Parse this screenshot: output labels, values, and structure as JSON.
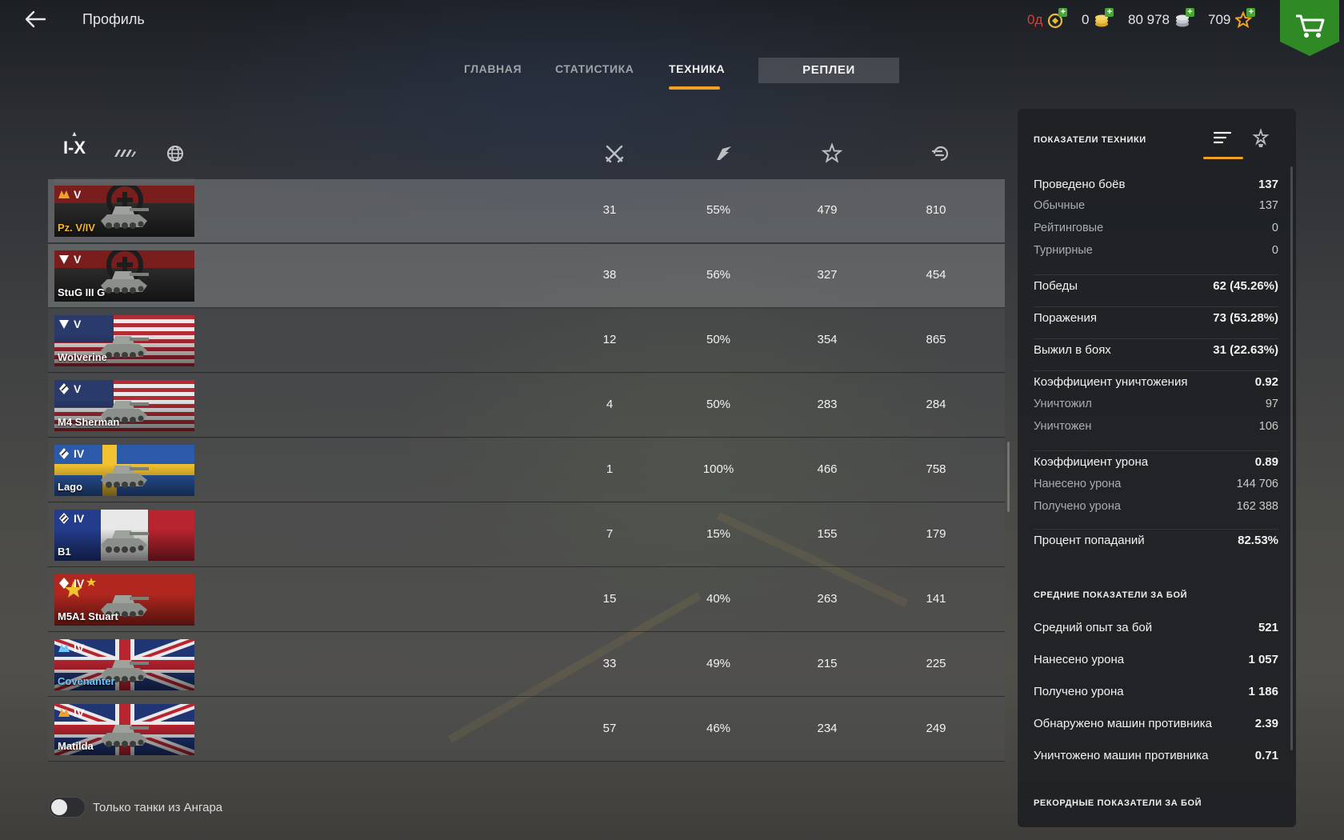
{
  "header": {
    "title": "Профиль",
    "currencies": [
      {
        "value": "0д",
        "icon": "premium-icon",
        "color": "#e83a2e"
      },
      {
        "value": "0",
        "icon": "gold-icon",
        "color": "#e4e4e4"
      },
      {
        "value": "80 978",
        "icon": "credits-icon",
        "color": "#e4e4e4"
      },
      {
        "value": "709",
        "icon": "free-xp-icon",
        "color": "#e4e4e4"
      }
    ],
    "plus": "+"
  },
  "tabs": {
    "main": "ГЛАВНАЯ",
    "stats": "СТАТИСТИКА",
    "vehicles": "ТЕХНИКА",
    "replays": "РЕПЛЕИ",
    "active": "vehicles"
  },
  "filters": {
    "tier": "I-X",
    "caret": "▲",
    "type_icon": "vehicle-type-icon",
    "nation_icon": "globe-icon"
  },
  "columns": [
    {
      "icon": "battles-icon"
    },
    {
      "icon": "winrate-icon"
    },
    {
      "icon": "avg-xp-icon"
    },
    {
      "icon": "avg-damage-icon"
    }
  ],
  "vehicles": [
    {
      "name": "Pz. V/IV",
      "tier": "V",
      "nation": "germany",
      "name_color": "#f5b82b",
      "badge": "mastery-icon",
      "battles": "31",
      "winrate": "55%",
      "xp": "479",
      "damage": "810",
      "highlighted": true
    },
    {
      "name": "StuG III G",
      "tier": "V",
      "nation": "germany",
      "name_color": "#ffffff",
      "badge": "td-icon",
      "battles": "38",
      "winrate": "56%",
      "xp": "327",
      "damage": "454",
      "highlighted": true
    },
    {
      "name": "Wolverine",
      "tier": "V",
      "nation": "usa",
      "name_color": "#ffffff",
      "badge": "td-icon",
      "battles": "12",
      "winrate": "50%",
      "xp": "354",
      "damage": "865",
      "highlighted": false
    },
    {
      "name": "M4 Sherman",
      "tier": "V",
      "nation": "usa",
      "name_color": "#ffffff",
      "badge": "medium-tank-icon",
      "battles": "4",
      "winrate": "50%",
      "xp": "283",
      "damage": "284",
      "highlighted": false
    },
    {
      "name": "Lago",
      "tier": "IV",
      "nation": "sweden",
      "name_color": "#ffffff",
      "badge": "medium-tank-icon",
      "battles": "1",
      "winrate": "100%",
      "xp": "466",
      "damage": "758",
      "highlighted": false
    },
    {
      "name": "B1",
      "tier": "IV",
      "nation": "france",
      "name_color": "#ffffff",
      "badge": "heavy-tank-icon",
      "battles": "7",
      "winrate": "15%",
      "xp": "155",
      "damage": "179",
      "highlighted": false
    },
    {
      "name": "M5A1 Stuart",
      "tier": "IV",
      "nation": "china",
      "name_color": "#ffffff",
      "badge": "light-tank-icon",
      "battles": "15",
      "winrate": "40%",
      "xp": "263",
      "damage": "141",
      "highlighted": false
    },
    {
      "name": "Covenanter",
      "tier": "IV",
      "nation": "uk",
      "name_color": "#6ec6ff",
      "badge": "mastery-icon",
      "battles": "33",
      "winrate": "49%",
      "xp": "215",
      "damage": "225",
      "highlighted": false
    },
    {
      "name": "Matilda",
      "tier": "IV",
      "nation": "uk",
      "name_color": "#ffffff",
      "badge": "mastery-icon",
      "battles": "57",
      "winrate": "46%",
      "xp": "234",
      "damage": "249",
      "highlighted": false
    }
  ],
  "toggle": {
    "label": "Только танки из Ангара",
    "on": false
  },
  "panel": {
    "title": "ПОКАЗАТЕЛИ ТЕХНИКИ",
    "tab_icons": [
      "list-icon",
      "trophy-icon"
    ],
    "stats": [
      {
        "label": "Проведено боёв",
        "value": "137",
        "kind": "main"
      },
      {
        "label": "Обычные",
        "value": "137",
        "kind": "sub"
      },
      {
        "label": "Рейтинговые",
        "value": "0",
        "kind": "sub"
      },
      {
        "label": "Турнирные",
        "value": "0",
        "kind": "sub"
      },
      {
        "label": "Победы",
        "value": "62 (45.26%)",
        "kind": "main"
      },
      {
        "label": "Поражения",
        "value": "73 (53.28%)",
        "kind": "main"
      },
      {
        "label": "Выжил в боях",
        "value": "31 (22.63%)",
        "kind": "main"
      },
      {
        "label": "Коэффициент уничтожения",
        "value": "0.92",
        "kind": "main"
      },
      {
        "label": "Уничтожил",
        "value": "97",
        "kind": "sub"
      },
      {
        "label": "Уничтожен",
        "value": "106",
        "kind": "sub"
      },
      {
        "label": "Коэффициент урона",
        "value": "0.89",
        "kind": "main"
      },
      {
        "label": "Нанесено урона",
        "value": "144 706",
        "kind": "sub"
      },
      {
        "label": "Получено урона",
        "value": "162 388",
        "kind": "sub"
      },
      {
        "label": "Процент попаданий",
        "value": "82.53%",
        "kind": "main"
      }
    ],
    "avg_title": "СРЕДНИЕ ПОКАЗАТЕЛИ ЗА БОЙ",
    "avg_stats": [
      {
        "label": "Средний опыт за бой",
        "value": "521"
      },
      {
        "label": "Нанесено урона",
        "value": "1 057"
      },
      {
        "label": "Получено урона",
        "value": "1 186"
      },
      {
        "label": "Обнаружено машин противника",
        "value": "2.39"
      },
      {
        "label": "Уничтожено машин противника",
        "value": "0.71"
      }
    ],
    "record_title": "РЕКОРДНЫЕ ПОКАЗАТЕЛИ ЗА БОЙ"
  },
  "colors": {
    "accent": "#f0a126",
    "shop": "#2f8a25",
    "plus": "#49a634"
  }
}
